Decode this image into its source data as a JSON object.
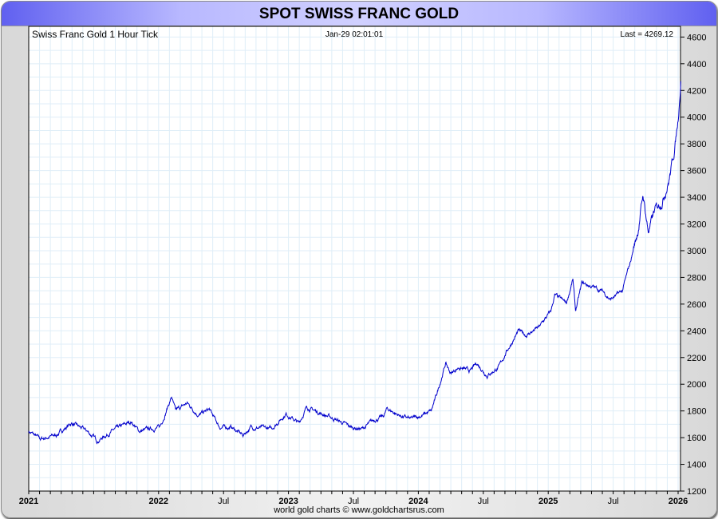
{
  "title": "SPOT SWISS FRANC GOLD",
  "footer": "world gold charts © www.goldchartsrus.com",
  "chart_data": {
    "type": "line",
    "title": "Swiss Franc Gold 1 Hour Tick",
    "timestamp": "Jan-29  02:01:01",
    "last_label": "Last = 4269.12",
    "last_value": 4269.12,
    "line_color": "#0000cc",
    "grid": true,
    "ylim": [
      1200,
      4680
    ],
    "y_ticks": [
      1200,
      1400,
      1600,
      1800,
      2000,
      2200,
      2400,
      2600,
      2800,
      3000,
      3200,
      3400,
      3600,
      3800,
      4000,
      4200,
      4400,
      4600
    ],
    "xlim": [
      2021.0,
      2026.08
    ],
    "x_ticks": [
      {
        "x": 2021.0,
        "label": "2021",
        "bold": true
      },
      {
        "x": 2022.0,
        "label": "2022",
        "bold": true
      },
      {
        "x": 2022.5,
        "label": "Jul",
        "bold": false
      },
      {
        "x": 2023.0,
        "label": "2023",
        "bold": true
      },
      {
        "x": 2023.5,
        "label": "Jul",
        "bold": false
      },
      {
        "x": 2024.0,
        "label": "2024",
        "bold": true
      },
      {
        "x": 2024.5,
        "label": "Jul",
        "bold": false
      },
      {
        "x": 2025.0,
        "label": "2025",
        "bold": true
      },
      {
        "x": 2025.5,
        "label": "Jul",
        "bold": false
      },
      {
        "x": 2026.0,
        "label": "2026",
        "bold": true
      }
    ],
    "points": [
      [
        2021.0,
        1648
      ],
      [
        2021.09,
        1588
      ],
      [
        2021.21,
        1618
      ],
      [
        2021.33,
        1708
      ],
      [
        2021.45,
        1648
      ],
      [
        2021.53,
        1576
      ],
      [
        2021.64,
        1648
      ],
      [
        2021.79,
        1720
      ],
      [
        2021.85,
        1648
      ],
      [
        2022.01,
        1678
      ],
      [
        2022.1,
        1905
      ],
      [
        2022.13,
        1798
      ],
      [
        2022.22,
        1858
      ],
      [
        2022.31,
        1768
      ],
      [
        2022.39,
        1810
      ],
      [
        2022.47,
        1678
      ],
      [
        2022.56,
        1678
      ],
      [
        2022.65,
        1618
      ],
      [
        2022.71,
        1678
      ],
      [
        2022.87,
        1666
      ],
      [
        2022.98,
        1780
      ],
      [
        2023.08,
        1708
      ],
      [
        2023.14,
        1828
      ],
      [
        2023.24,
        1786
      ],
      [
        2023.36,
        1738
      ],
      [
        2023.48,
        1678
      ],
      [
        2023.57,
        1666
      ],
      [
        2023.67,
        1738
      ],
      [
        2023.73,
        1756
      ],
      [
        2023.76,
        1816
      ],
      [
        2023.85,
        1768
      ],
      [
        2023.94,
        1738
      ],
      [
        2024.03,
        1768
      ],
      [
        2024.1,
        1798
      ],
      [
        2024.14,
        1918
      ],
      [
        2024.21,
        2157
      ],
      [
        2024.25,
        2079
      ],
      [
        2024.31,
        2127
      ],
      [
        2024.4,
        2097
      ],
      [
        2024.45,
        2157
      ],
      [
        2024.53,
        2067
      ],
      [
        2024.62,
        2127
      ],
      [
        2024.68,
        2247
      ],
      [
        2024.77,
        2397
      ],
      [
        2024.83,
        2367
      ],
      [
        2024.93,
        2427
      ],
      [
        2025.02,
        2546
      ],
      [
        2025.05,
        2666
      ],
      [
        2025.14,
        2606
      ],
      [
        2025.19,
        2786
      ],
      [
        2025.21,
        2546
      ],
      [
        2025.26,
        2756
      ],
      [
        2025.35,
        2726
      ],
      [
        2025.42,
        2696
      ],
      [
        2025.48,
        2636
      ],
      [
        2025.57,
        2696
      ],
      [
        2025.63,
        2906
      ],
      [
        2025.69,
        3145
      ],
      [
        2025.73,
        3415
      ],
      [
        2025.77,
        3145
      ],
      [
        2025.82,
        3295
      ],
      [
        2025.88,
        3385
      ],
      [
        2025.93,
        3535
      ],
      [
        2025.97,
        3744
      ],
      [
        2026.0,
        3983
      ],
      [
        2026.02,
        4269
      ]
    ]
  }
}
